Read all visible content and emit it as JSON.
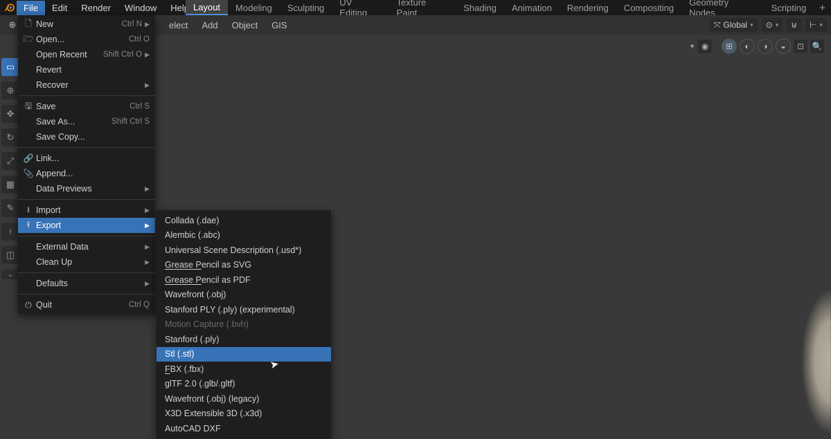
{
  "topMenu": {
    "file": "File",
    "edit": "Edit",
    "render": "Render",
    "window": "Window",
    "help": "Help"
  },
  "workspaces": {
    "layout": "Layout",
    "modeling": "Modeling",
    "sculpting": "Sculpting",
    "uv": "UV Editing",
    "texture": "Texture Paint",
    "shading": "Shading",
    "animation": "Animation",
    "rendering": "Rendering",
    "compositing": "Compositing",
    "geometry": "Geometry Nodes",
    "scripting": "Scripting",
    "add": "+"
  },
  "subheader": {
    "elect": "elect",
    "add": "Add",
    "object": "Object",
    "gis": "GIS"
  },
  "headerRight": {
    "orientation": "Global"
  },
  "fileMenu": {
    "new": {
      "label": "New",
      "shortcut": "Ctrl N"
    },
    "open": {
      "label": "Open...",
      "shortcut": "Ctrl O"
    },
    "openRecent": {
      "label": "Open Recent",
      "shortcut": "Shift Ctrl O"
    },
    "revert": {
      "label": "Revert"
    },
    "recover": {
      "label": "Recover"
    },
    "save": {
      "label": "Save",
      "shortcut": "Ctrl S"
    },
    "saveAs": {
      "label": "Save As...",
      "shortcut": "Shift Ctrl S"
    },
    "saveCopy": {
      "label": "Save Copy..."
    },
    "link": {
      "label": "Link..."
    },
    "append": {
      "label": "Append..."
    },
    "dataPreviews": {
      "label": "Data Previews"
    },
    "import": {
      "label": "Import"
    },
    "export": {
      "label": "Export"
    },
    "externalData": {
      "label": "External Data"
    },
    "cleanUp": {
      "label": "Clean Up"
    },
    "defaults": {
      "label": "Defaults"
    },
    "quit": {
      "label": "Quit",
      "shortcut": "Ctrl Q"
    }
  },
  "exportMenu": {
    "collada": "Collada (.dae)",
    "alembic": "Alembic (.abc)",
    "usd": "Universal Scene Description (.usd*)",
    "gpSvg": "Grease Pencil as SVG",
    "gpPdf": "Grease Pencil as PDF",
    "wavefront": "Wavefront (.obj)",
    "stanfordExp": "Stanford PLY (.ply) (experimental)",
    "bvh": "Motion Capture (.bvh)",
    "stanford": "Stanford (.ply)",
    "stl": "Stl (.stl)",
    "fbx": "FBX (.fbx)",
    "gltf": "glTF 2.0 (.glb/.gltf)",
    "wavefrontLegacy": "Wavefront (.obj) (legacy)",
    "x3d": "X3D Extensible 3D (.x3d)",
    "dxf": "AutoCAD DXF"
  }
}
